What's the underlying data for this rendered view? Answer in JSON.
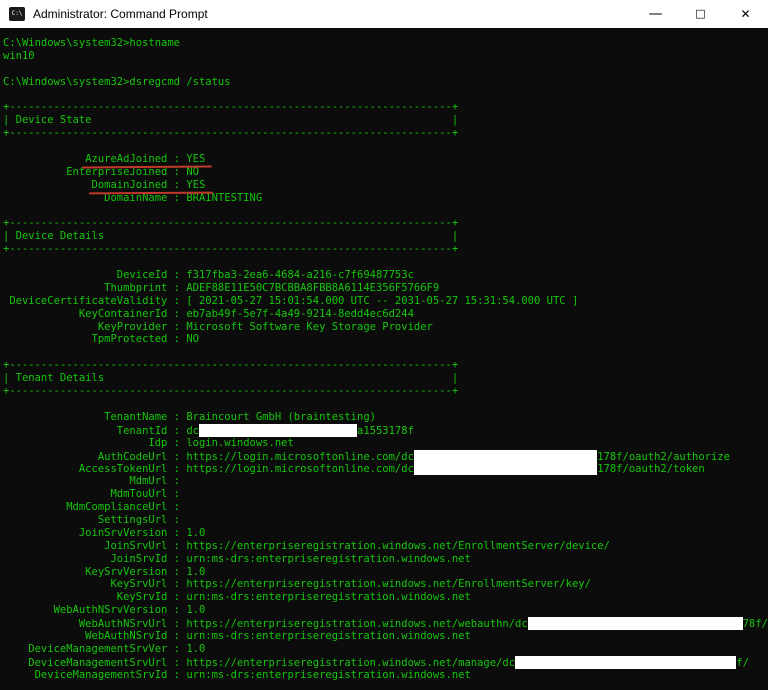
{
  "window": {
    "title": "Administrator: Command Prompt",
    "icon": "cmd-icon",
    "controls": {
      "minimize": "—",
      "maximize": "□",
      "close": "✕"
    },
    "titlebar_bg": "#ffffff",
    "titlebar_fg": "#000000"
  },
  "terminal": {
    "colors": {
      "background": "#0c0c0c",
      "foreground": "#16c60c",
      "annotation_red": "#c0392b",
      "redaction_white": "#ffffff"
    },
    "lines": [
      [
        {
          "t": "C:\\Windows\\system32>hostname"
        }
      ],
      [
        {
          "t": "win10"
        }
      ],
      [],
      [
        {
          "t": "C:\\Windows\\system32>dsregcmd /status"
        }
      ],
      [],
      [
        {
          "box": "edge"
        }
      ],
      [
        {
          "box": "title",
          "t": "Device State"
        }
      ],
      [
        {
          "box": "edge"
        }
      ],
      [],
      [
        {
          "t": "             "
        },
        {
          "t": "AzureAdJoined : YES",
          "u": true
        }
      ],
      [
        {
          "t": "          EnterpriseJoined : NO"
        }
      ],
      [
        {
          "t": "              "
        },
        {
          "t": "DomainJoined : YES",
          "u": true
        }
      ],
      [
        {
          "t": "                DomainName : BRAINTESTING"
        }
      ],
      [],
      [
        {
          "box": "edge"
        }
      ],
      [
        {
          "box": "title",
          "t": "Device Details"
        }
      ],
      [
        {
          "box": "edge"
        }
      ],
      [],
      [
        {
          "t": "                  DeviceId : f317fba3-2ea6-4684-a216-c7f69487753c"
        }
      ],
      [
        {
          "t": "                Thumbprint : ADEF88E11E50C7BCBBA8FBB8A6114E356F5766F9"
        }
      ],
      [
        {
          "t": " DeviceCertificateValidity : [ 2021-05-27 15:01:54.000 UTC -- 2031-05-27 15:31:54.000 UTC ]"
        }
      ],
      [
        {
          "t": "            KeyContainerId : eb7ab49f-5e7f-4a49-9214-8edd4ec6d244"
        }
      ],
      [
        {
          "t": "               KeyProvider : Microsoft Software Key Storage Provider"
        }
      ],
      [
        {
          "t": "              TpmProtected : NO"
        }
      ],
      [],
      [
        {
          "box": "edge"
        }
      ],
      [
        {
          "box": "title",
          "t": "Tenant Details"
        }
      ],
      [
        {
          "box": "edge"
        }
      ],
      [],
      [
        {
          "t": "                TenantName : Braincourt GmbH (braintesting)"
        }
      ],
      [
        {
          "t": "                  TenantId : dc"
        },
        {
          "r": 25
        },
        {
          "t": "a1553178f"
        }
      ],
      [
        {
          "t": "                       Idp : login.windows.net"
        }
      ],
      [
        {
          "t": "               AuthCodeUrl : https://login.microsoftonline.com/dc"
        },
        {
          "r": 29
        },
        {
          "t": "178f/oauth2/authorize"
        }
      ],
      [
        {
          "t": "            AccessTokenUrl : https://login.microsoftonline.com/dc"
        },
        {
          "r": 29
        },
        {
          "t": "178f/oauth2/token"
        }
      ],
      [
        {
          "t": "                    MdmUrl :"
        }
      ],
      [
        {
          "t": "                 MdmTouUrl :"
        }
      ],
      [
        {
          "t": "          MdmComplianceUrl :"
        }
      ],
      [
        {
          "t": "               SettingsUrl :"
        }
      ],
      [
        {
          "t": "            JoinSrvVersion : 1.0"
        }
      ],
      [
        {
          "t": "                JoinSrvUrl : https://enterpriseregistration.windows.net/EnrollmentServer/device/"
        }
      ],
      [
        {
          "t": "                 JoinSrvId : urn:ms-drs:enterpriseregistration.windows.net"
        }
      ],
      [
        {
          "t": "             KeySrvVersion : 1.0"
        }
      ],
      [
        {
          "t": "                 KeySrvUrl : https://enterpriseregistration.windows.net/EnrollmentServer/key/"
        }
      ],
      [
        {
          "t": "                  KeySrvId : urn:ms-drs:enterpriseregistration.windows.net"
        }
      ],
      [
        {
          "t": "        WebAuthNSrvVersion : 1.0"
        }
      ],
      [
        {
          "t": "            WebAuthNSrvUrl : https://enterpriseregistration.windows.net/webauthn/dc"
        },
        {
          "r": 34
        },
        {
          "t": "78f/"
        }
      ],
      [
        {
          "t": "             WebAuthNSrvId : urn:ms-drs:enterpriseregistration.windows.net"
        }
      ],
      [
        {
          "t": "    DeviceManagementSrvVer : 1.0"
        }
      ],
      [
        {
          "t": "    DeviceManagementSrvUrl : https://enterpriseregistration.windows.net/manage/dc"
        },
        {
          "r": 35
        },
        {
          "t": "f/"
        }
      ],
      [
        {
          "t": "     DeviceManagementSrvId : urn:ms-drs:enterpriseregistration.windows.net"
        }
      ]
    ]
  }
}
